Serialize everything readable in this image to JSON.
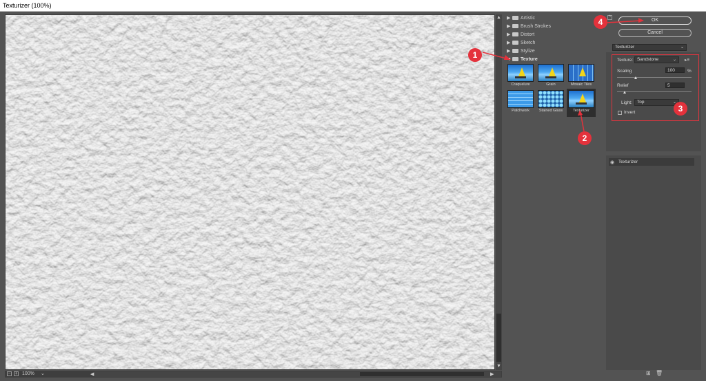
{
  "window": {
    "title": "Texturizer (100%)"
  },
  "preview": {
    "zoom": "100%"
  },
  "gallery": {
    "categories": [
      {
        "label": "Artistic",
        "expanded": false
      },
      {
        "label": "Brush Strokes",
        "expanded": false
      },
      {
        "label": "Distort",
        "expanded": false
      },
      {
        "label": "Sketch",
        "expanded": false
      },
      {
        "label": "Stylize",
        "expanded": false
      },
      {
        "label": "Texture",
        "expanded": true
      }
    ],
    "filters": [
      {
        "label": "Craquelure"
      },
      {
        "label": "Grain"
      },
      {
        "label": "Mosaic Tiles"
      },
      {
        "label": "Patchwork"
      },
      {
        "label": "Stained Glass"
      },
      {
        "label": "Texturizer",
        "selected": true
      }
    ]
  },
  "buttons": {
    "ok": "OK",
    "cancel": "Cancel"
  },
  "filter_select": {
    "value": "Texturizer"
  },
  "settings": {
    "texture_label": "Texture:",
    "texture_value": "Sandstone",
    "scaling_label": "Scaling",
    "scaling_value": "100",
    "scaling_unit": "%",
    "scaling_slider": 0.25,
    "relief_label": "Relief",
    "relief_value": "5",
    "relief_slider": 0.1,
    "light_label": "Light:",
    "light_value": "Top",
    "invert_label": "Invert",
    "invert_checked": false
  },
  "layers": [
    {
      "label": "Texturizer",
      "visible": true
    }
  ],
  "annotations": {
    "badges": [
      "1",
      "2",
      "3",
      "4"
    ],
    "color": "#e4323c"
  },
  "icons": {
    "menu": "menu-icon",
    "visibility": "eye-icon",
    "new_layer": "new-layer-icon",
    "delete": "trash-icon"
  }
}
